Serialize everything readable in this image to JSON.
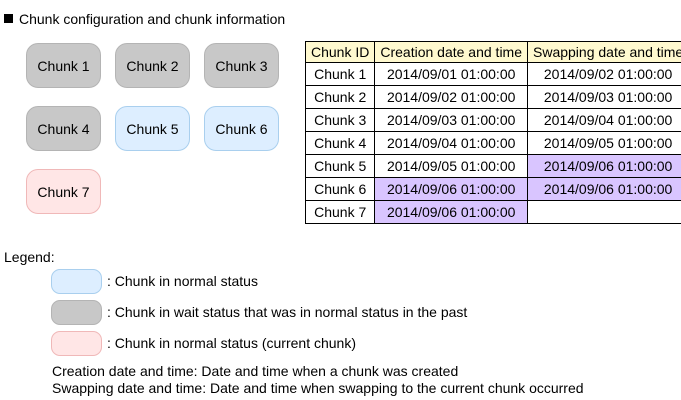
{
  "title": "Chunk configuration and chunk information",
  "chunks": [
    {
      "label": "Chunk 1",
      "status": "wait"
    },
    {
      "label": "Chunk 2",
      "status": "wait"
    },
    {
      "label": "Chunk 3",
      "status": "wait"
    },
    {
      "label": "Chunk 4",
      "status": "wait"
    },
    {
      "label": "Chunk 5",
      "status": "normal"
    },
    {
      "label": "Chunk 6",
      "status": "normal"
    },
    {
      "label": "Chunk 7",
      "status": "current"
    }
  ],
  "table": {
    "headers": [
      "Chunk ID",
      "Creation date and time",
      "Swapping date and time"
    ],
    "rows": [
      {
        "id": "Chunk 1",
        "created": "2014/09/01 01:00:00",
        "swapped": "2014/09/02 01:00:00"
      },
      {
        "id": "Chunk 2",
        "created": "2014/09/02 01:00:00",
        "swapped": "2014/09/03 01:00:00"
      },
      {
        "id": "Chunk 3",
        "created": "2014/09/03 01:00:00",
        "swapped": "2014/09/04 01:00:00"
      },
      {
        "id": "Chunk 4",
        "created": "2014/09/04 01:00:00",
        "swapped": "2014/09/05 01:00:00"
      },
      {
        "id": "Chunk 5",
        "created": "2014/09/05 01:00:00",
        "swapped": "2014/09/06 01:00:00"
      },
      {
        "id": "Chunk 6",
        "created": "2014/09/06 01:00:00",
        "swapped": "2014/09/06 01:00:00"
      },
      {
        "id": "Chunk 7",
        "created": "2014/09/06 01:00:00",
        "swapped": ""
      }
    ]
  },
  "legend": {
    "label": "Legend:",
    "normal": ": Chunk in normal status",
    "wait": ": Chunk in wait status that was in normal status in the past",
    "current": ": Chunk in normal status (current chunk)"
  },
  "notes": {
    "creation": "Creation date and time: Date and time when a chunk was created",
    "swapping": "Swapping date and time: Date and time when swapping to the current chunk occurred"
  },
  "colors": {
    "wait": "#c8c8c8",
    "normal": "#ddeeff",
    "current": "#ffe6e6",
    "header": "#fff9cf",
    "highlight": "#d9c5ff"
  }
}
